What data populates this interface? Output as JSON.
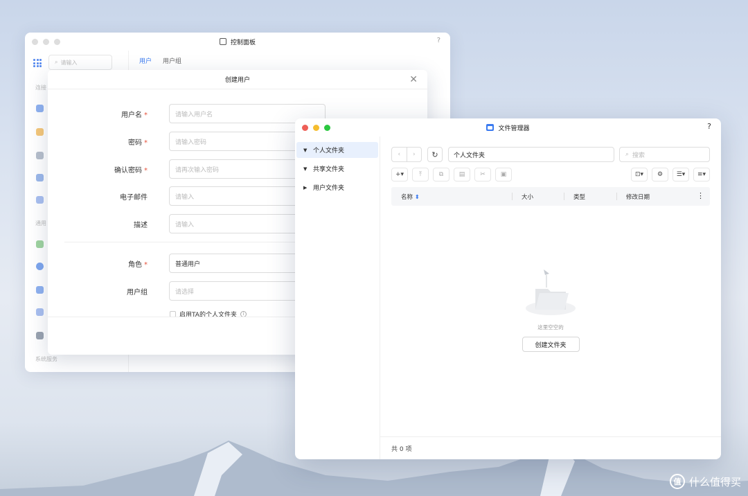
{
  "control_panel": {
    "title": "控制面板",
    "help": "?",
    "search_placeholder": "请输入",
    "section1": "连接",
    "section2": "通用",
    "section3": "系统服务",
    "tabs": [
      "用户",
      "用户组"
    ]
  },
  "dialog": {
    "title": "创建用户",
    "close": "✕",
    "fields": [
      {
        "label": "用户名",
        "required": "*",
        "placeholder": "请输入用户名",
        "value": ""
      },
      {
        "label": "密码",
        "required": "*",
        "placeholder": "请输入密码",
        "value": ""
      },
      {
        "label": "确认密码",
        "required": "*",
        "placeholder": "请再次输入密码",
        "value": ""
      },
      {
        "label": "电子邮件",
        "required": "",
        "placeholder": "请输入",
        "value": ""
      },
      {
        "label": "描述",
        "required": "",
        "placeholder": "请输入",
        "value": ""
      },
      {
        "label": "角色",
        "required": "*",
        "placeholder": "",
        "value": "普通用户"
      },
      {
        "label": "用户组",
        "required": "",
        "placeholder": "请选择",
        "value": ""
      }
    ],
    "checkbox_label": "启用TA的个人文件夹",
    "info": "i"
  },
  "file_manager": {
    "title": "文件管理器",
    "help": "?",
    "sidebar": [
      {
        "label": "个人文件夹",
        "active": true
      },
      {
        "label": "共享文件夹",
        "active": false
      },
      {
        "label": "用户文件夹",
        "active": false
      }
    ],
    "path": "个人文件夹",
    "search_placeholder": "搜索",
    "columns": {
      "name": "名称",
      "size": "大小",
      "type": "类型",
      "modified": "修改日期"
    },
    "empty_text": "这里空空的",
    "create_folder": "创建文件夹",
    "footer": "共 0 项"
  },
  "watermark": {
    "text": "什么值得买",
    "logo": "值"
  },
  "colors": {
    "accent": "#3b7bf0",
    "required": "#e5533d",
    "close_red": "#ee5f57",
    "min_yellow": "#f5bd2f",
    "max_green": "#2bc840"
  }
}
